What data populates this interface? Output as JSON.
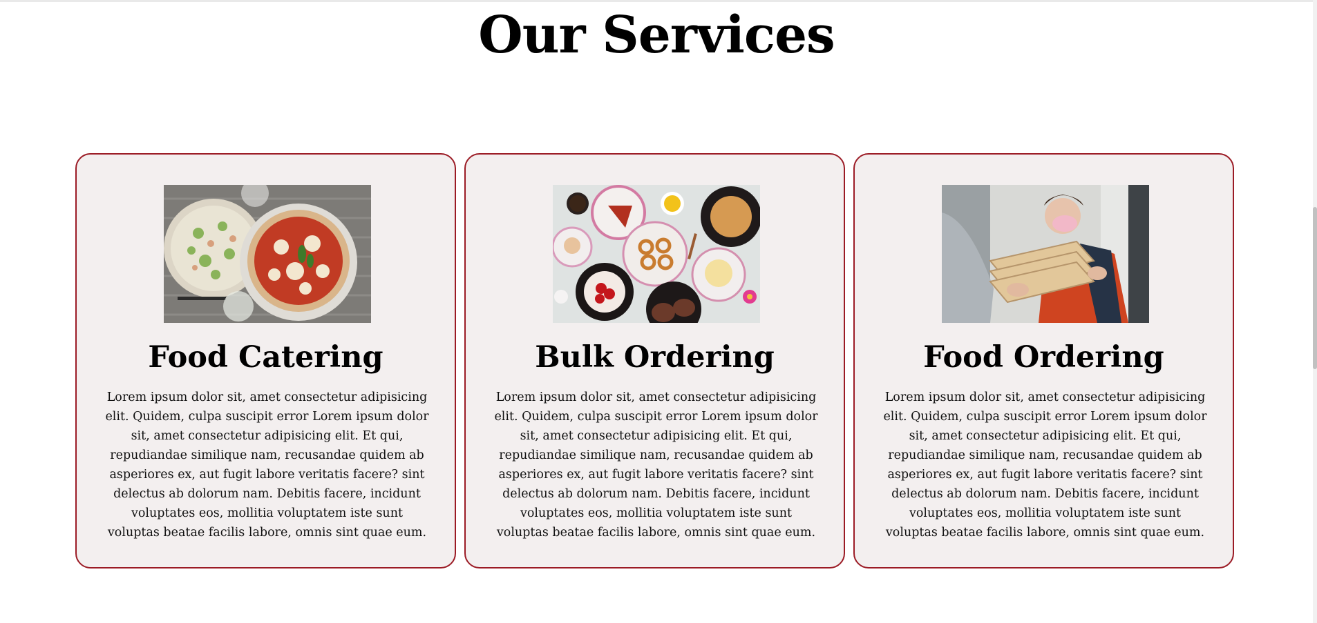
{
  "section": {
    "title": "Our Services"
  },
  "cards": [
    {
      "title": "Food Catering",
      "image": "two-pizzas-photo",
      "text": "Lorem ipsum dolor sit, amet consectetur adipisicing elit. Quidem, culpa suscipit error Lorem ipsum dolor sit, amet consectetur adipisicing elit. Et qui, repudiandae similique nam, recusandae quidem ab asperiores ex, aut fugit labore veritatis facere? sint delectus ab dolorum nam. Debitis facere, incidunt voluptates eos, mollitia voluptatem iste sunt voluptas beatae facilis labore, omnis sint quae eum."
    },
    {
      "title": "Bulk Ordering",
      "image": "dessert-spread-photo",
      "text": "Lorem ipsum dolor sit, amet consectetur adipisicing elit. Quidem, culpa suscipit error Lorem ipsum dolor sit, amet consectetur adipisicing elit. Et qui, repudiandae similique nam, recusandae quidem ab asperiores ex, aut fugit labore veritatis facere? sint delectus ab dolorum nam. Debitis facere, incidunt voluptates eos, mollitia voluptatem iste sunt voluptas beatae facilis labore, omnis sint quae eum."
    },
    {
      "title": "Food Ordering",
      "image": "pizza-delivery-photo",
      "text": "Lorem ipsum dolor sit, amet consectetur adipisicing elit. Quidem, culpa suscipit error Lorem ipsum dolor sit, amet consectetur adipisicing elit. Et qui, repudiandae similique nam, recusandae quidem ab asperiores ex, aut fugit labore veritatis facere? sint delectus ab dolorum nam. Debitis facere, incidunt voluptates eos, mollitia voluptatem iste sunt voluptas beatae facilis labore, omnis sint quae eum."
    }
  ],
  "colors": {
    "card_border": "#9b1b25",
    "card_background": "#f3efef",
    "heading": "#000000"
  }
}
